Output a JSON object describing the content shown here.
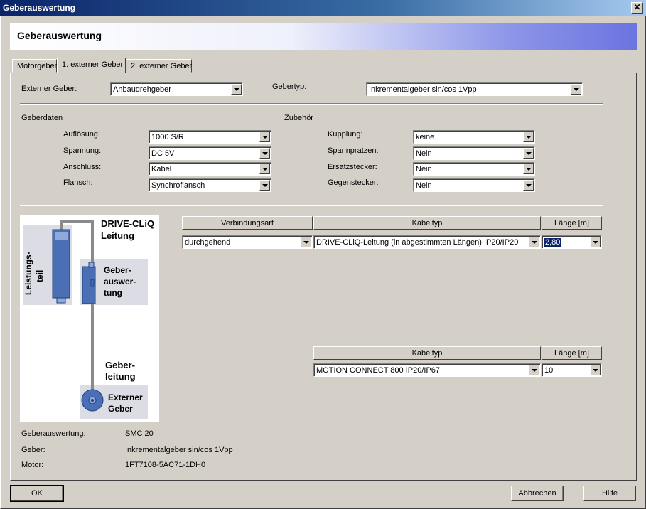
{
  "window": {
    "title": "Geberauswertung",
    "close_icon": "close-icon"
  },
  "banner": {
    "title": "Geberauswertung"
  },
  "tabs": [
    {
      "label": "Motorgeber"
    },
    {
      "label": "1. externer Geber"
    },
    {
      "label": "2. externer Geber"
    }
  ],
  "top": {
    "externer_geber_label": "Externer Geber:",
    "externer_geber_value": "Anbaudrehgeber",
    "gebertyp_label": "Gebertyp:",
    "gebertyp_value": "Inkrementalgeber sin/cos 1Vpp"
  },
  "geberdaten": {
    "heading": "Geberdaten",
    "fields": [
      {
        "label": "Auflösung:",
        "value": "1000 S/R"
      },
      {
        "label": "Spannung:",
        "value": "DC 5V"
      },
      {
        "label": "Anschluss:",
        "value": "Kabel"
      },
      {
        "label": "Flansch:",
        "value": "Synchroflansch"
      }
    ]
  },
  "zubehoer": {
    "heading": "Zubehör",
    "fields": [
      {
        "label": "Kupplung:",
        "value": "keine"
      },
      {
        "label": "Spannpratzen:",
        "value": "Nein"
      },
      {
        "label": "Ersatzstecker:",
        "value": "Nein"
      },
      {
        "label": "Gegenstecker:",
        "value": "Nein"
      }
    ]
  },
  "diagram": {
    "drive_cliq_1": "DRIVE-CLiQ",
    "drive_cliq_2": "Leitung",
    "leistungsteil_1": "Leistungs-",
    "leistungsteil_2": "teil",
    "geberauswertung_1": "Geber-",
    "geberauswertung_2": "auswer-",
    "geberauswertung_3": "tung",
    "geberleitung_1": "Geber-",
    "geberleitung_2": "leitung",
    "externer_geber_1": "Externer",
    "externer_geber_2": "Geber"
  },
  "cable1": {
    "col_verbindungsart": "Verbindungsart",
    "col_kabeltyp": "Kabeltyp",
    "col_laenge": "Länge [m]",
    "verbindungsart": "durchgehend",
    "kabeltyp": "DRIVE-CLiQ-Leitung (in abgestimmten Längen) IP20/IP20",
    "laenge": "2,80"
  },
  "cable2": {
    "col_kabeltyp": "Kabeltyp",
    "col_laenge": "Länge [m]",
    "kabeltyp": "MOTION CONNECT 800 IP20/IP67",
    "laenge": "10"
  },
  "summary": [
    {
      "label": "Geberauswertung:",
      "value": "SMC 20"
    },
    {
      "label": "Geber:",
      "value": "Inkrementalgeber sin/cos 1Vpp"
    },
    {
      "label": "Motor:",
      "value": "1FT7108-5AC71-1DH0"
    }
  ],
  "buttons": {
    "ok": "OK",
    "abbrechen": "Abbrechen",
    "hilfe": "Hilfe"
  }
}
